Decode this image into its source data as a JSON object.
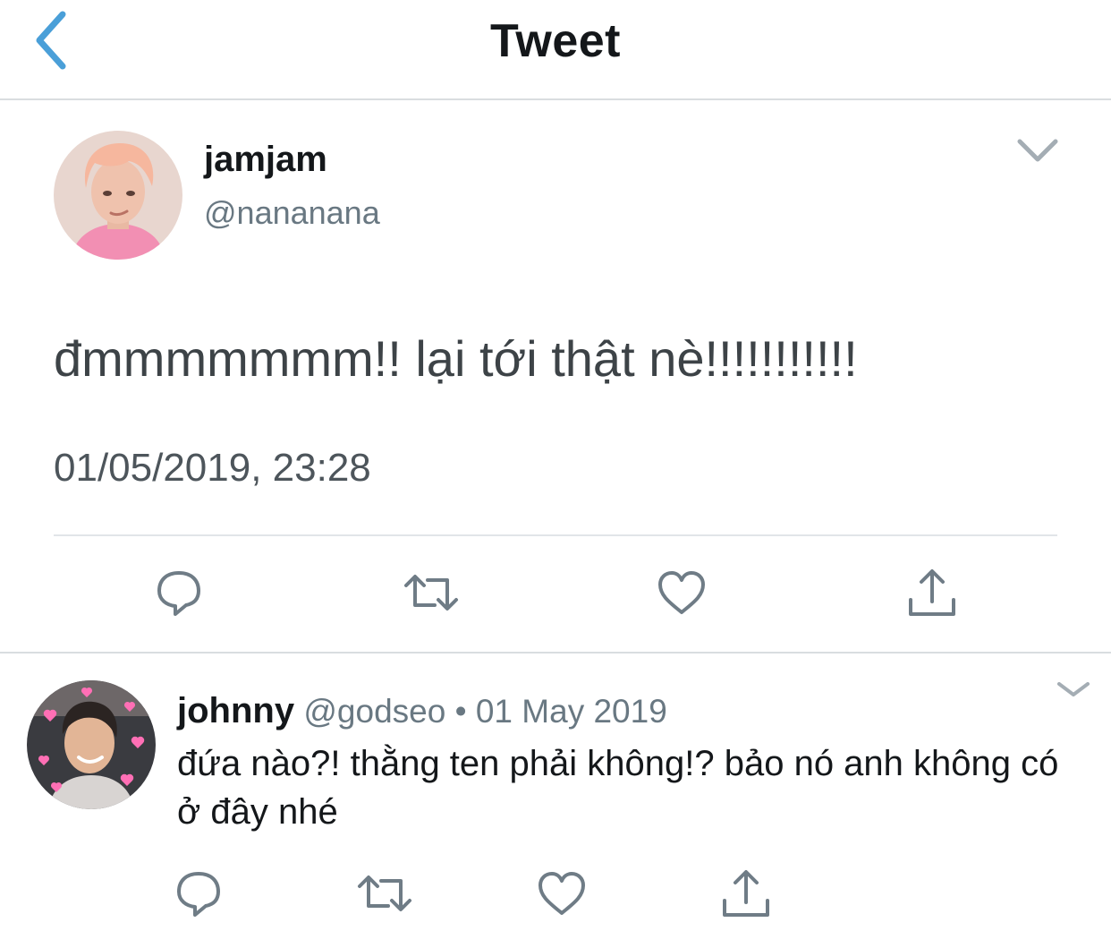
{
  "header": {
    "title": "Tweet",
    "back_icon": "chevron-left-icon"
  },
  "colors": {
    "accent": "#4a9fd8",
    "icon_gray": "#6f7c86",
    "text_gray": "#697882",
    "divider": "#e1e5e8"
  },
  "main_tweet": {
    "author_name": "jamjam",
    "author_handle": "@nananana",
    "text": "đmmmmmmm!! lại tới thật nè!!!!!!!!!!!",
    "timestamp": "01/05/2019, 23:28",
    "menu_icon": "chevron-down-icon",
    "actions": [
      "reply-icon",
      "retweet-icon",
      "like-icon",
      "share-icon"
    ]
  },
  "reply": {
    "author_name": "johnny",
    "author_handle": "@godseo",
    "separator": "•",
    "date": "01 May 2019",
    "text": "đứa nào?! thằng ten phải không!? bảo nó anh không có ở đây nhé",
    "menu_icon": "chevron-down-icon",
    "actions": [
      "reply-icon",
      "retweet-icon",
      "like-icon",
      "share-icon"
    ]
  }
}
